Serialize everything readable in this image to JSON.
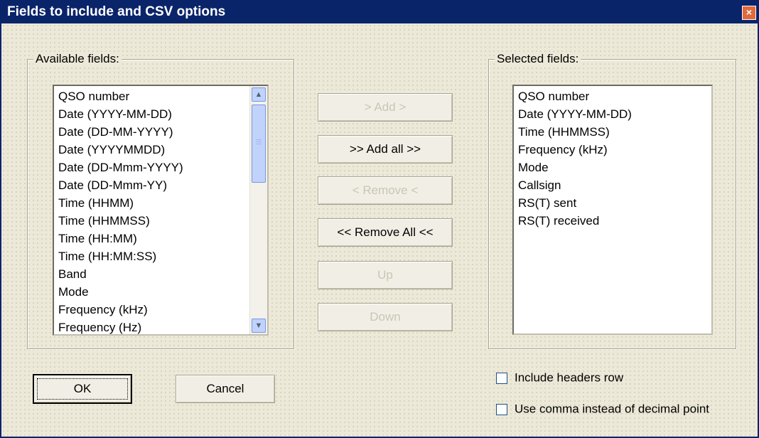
{
  "window": {
    "title": "Fields to include and CSV options",
    "close_glyph": "×"
  },
  "available": {
    "label": "Available fields:",
    "items": [
      "QSO number",
      "Date (YYYY-MM-DD)",
      "Date (DD-MM-YYYY)",
      "Date (YYYYMMDD)",
      "Date (DD-Mmm-YYYY)",
      "Date (DD-Mmm-YY)",
      "Time (HHMM)",
      "Time (HHMMSS)",
      "Time (HH:MM)",
      "Time (HH:MM:SS)",
      "Band",
      "Mode",
      "Frequency (kHz)",
      "Frequency (Hz)"
    ]
  },
  "selected": {
    "label": "Selected fields:",
    "items": [
      "QSO number",
      "Date (YYYY-MM-DD)",
      "Time (HHMMSS)",
      "Frequency (kHz)",
      "Mode",
      "Callsign",
      "RS(T) sent",
      "RS(T) received"
    ]
  },
  "buttons": {
    "add": "> Add >",
    "add_all": ">> Add all >>",
    "remove": "< Remove <",
    "remove_all": "<< Remove All <<",
    "up": "Up",
    "down": "Down",
    "ok": "OK",
    "cancel": "Cancel"
  },
  "options": {
    "include_headers": "Include headers row",
    "use_comma": "Use comma instead of decimal point"
  },
  "scroll_glyphs": {
    "up": "▲",
    "down": "▼"
  }
}
